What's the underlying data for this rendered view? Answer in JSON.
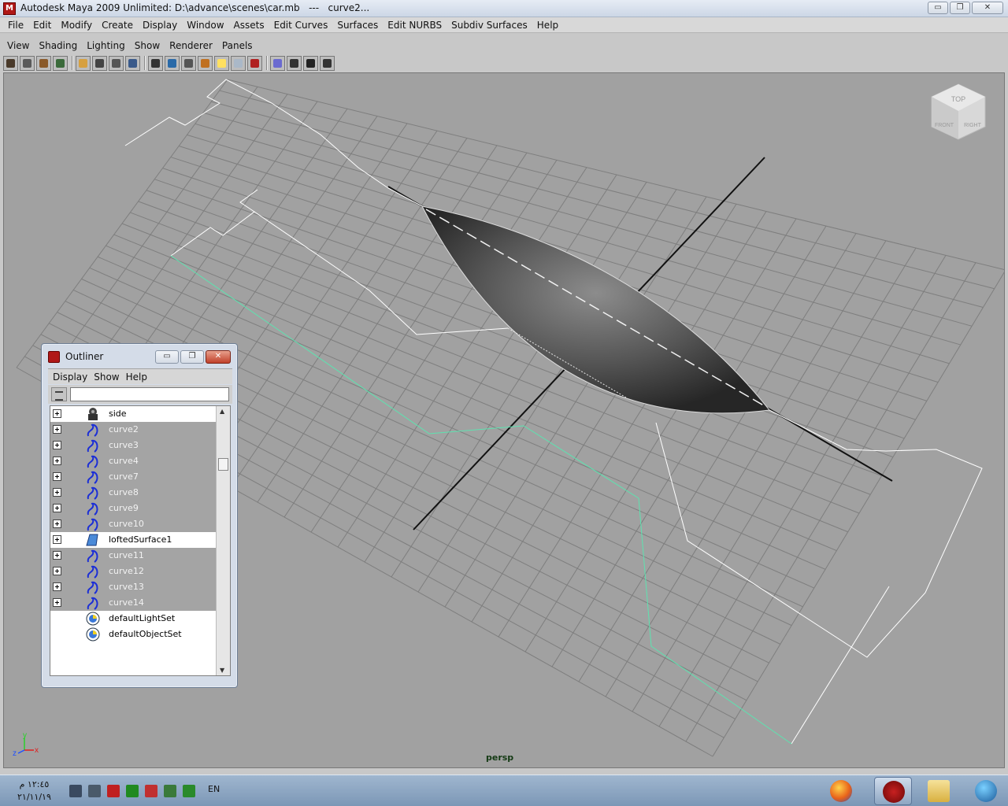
{
  "window": {
    "title": "Autodesk Maya 2009 Unlimited: D:\\advance\\scenes\\car.mb   ---   curve2...",
    "minimize": "▭",
    "restore": "❐",
    "close": "✕"
  },
  "main_menu": [
    "File",
    "Edit",
    "Modify",
    "Create",
    "Display",
    "Window",
    "Assets",
    "Edit Curves",
    "Surfaces",
    "Edit NURBS",
    "Subdiv Surfaces",
    "Help"
  ],
  "panel_menu": [
    "View",
    "Shading",
    "Lighting",
    "Show",
    "Renderer",
    "Panels"
  ],
  "toolbar_icons": [
    "camera-attributes-icon",
    "camera-tools-icon",
    "bookmark-icon",
    "image-plane-icon",
    "grid-toggle-icon",
    "film-gate-icon",
    "resolution-gate-icon",
    "safe-action-icon",
    "wireframe-icon",
    "smooth-shade-icon",
    "default-light-icon",
    "texture-icon",
    "shadow-icon",
    "isolate-select-icon",
    "xray-icon",
    "frame-all-icon",
    "frame-selection-icon",
    "hud-icon",
    "render-icon"
  ],
  "viewport": {
    "camera": "persp",
    "viewcube": {
      "top": "TOP",
      "front": "FRONT",
      "right": "RIGHT"
    },
    "axis": {
      "y": "y",
      "z": "z",
      "x": "x"
    }
  },
  "outliner": {
    "title": "Outliner",
    "menu": [
      "Display",
      "Show",
      "Help"
    ],
    "filter_value": "",
    "items": [
      {
        "label": "side",
        "icon": "camera-icon",
        "expandable": true,
        "dim": false
      },
      {
        "label": "curve2",
        "icon": "nurbs-curve-icon",
        "expandable": true,
        "dim": true
      },
      {
        "label": "curve3",
        "icon": "nurbs-curve-icon",
        "expandable": true,
        "dim": true
      },
      {
        "label": "curve4",
        "icon": "nurbs-curve-icon",
        "expandable": true,
        "dim": true
      },
      {
        "label": "curve7",
        "icon": "nurbs-curve-icon",
        "expandable": true,
        "dim": true
      },
      {
        "label": "curve8",
        "icon": "nurbs-curve-icon",
        "expandable": true,
        "dim": true
      },
      {
        "label": "curve9",
        "icon": "nurbs-curve-icon",
        "expandable": true,
        "dim": true
      },
      {
        "label": "curve10",
        "icon": "nurbs-curve-icon",
        "expandable": true,
        "dim": true
      },
      {
        "label": "loftedSurface1",
        "icon": "nurbs-surface-icon",
        "expandable": true,
        "dim": false
      },
      {
        "label": "curve11",
        "icon": "nurbs-curve-icon",
        "expandable": true,
        "dim": true
      },
      {
        "label": "curve12",
        "icon": "nurbs-curve-icon",
        "expandable": true,
        "dim": true
      },
      {
        "label": "curve13",
        "icon": "nurbs-curve-icon",
        "expandable": true,
        "dim": true
      },
      {
        "label": "curve14",
        "icon": "nurbs-curve-icon",
        "expandable": true,
        "dim": true
      },
      {
        "label": "defaultLightSet",
        "icon": "set-icon",
        "expandable": false,
        "dim": false
      },
      {
        "label": "defaultObjectSet",
        "icon": "set-icon",
        "expandable": false,
        "dim": false
      }
    ]
  },
  "taskbar": {
    "time": "١٢:٤٥ م",
    "date": "٢١/١١/١٩",
    "language": "EN",
    "tray_icons": [
      "volume-icon",
      "network-icon",
      "error-icon",
      "app-tray-icon",
      "flag-icon",
      "sync-icon",
      "security-icon"
    ],
    "buttons": [
      "firefox-icon",
      "maya-icon",
      "folder-icon",
      "start-orb-icon"
    ]
  },
  "colors": {
    "viewport_bg": "#a1a1a1",
    "grid": "#7e7e7e",
    "axis": "#111111",
    "selected_curve": "#5de3b0",
    "curve": "#ffffff",
    "surface_dark": "#2e2e2e",
    "surface_light": "#8a8a8a"
  }
}
